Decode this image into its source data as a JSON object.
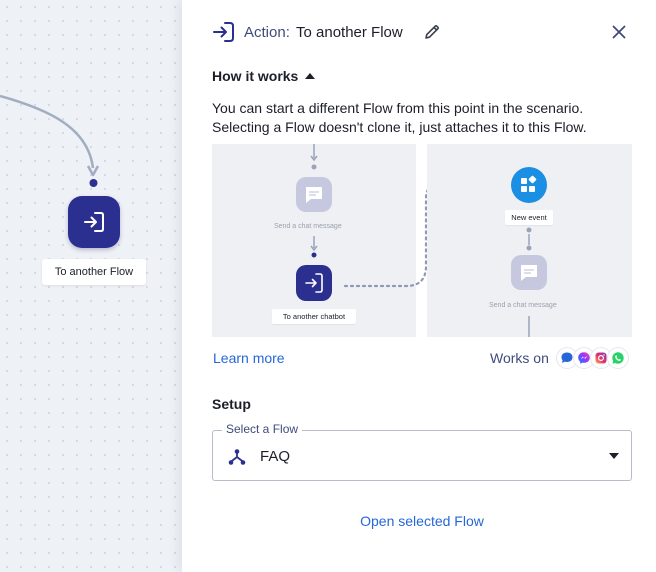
{
  "canvas": {
    "node_label": "To another Flow"
  },
  "panel": {
    "action_prefix": "Action:",
    "action_title": "To another Flow",
    "how_it_works_label": "How it works",
    "description": "You can start a different Flow from this point in the scenario. Selecting a Flow doesn't clone it, just attaches it to this Flow.",
    "illustration": {
      "send_chat_top": "Send a chat message",
      "to_another_chatbot": "To another chatbot",
      "new_event": "New event",
      "send_chat_bottom": "Send a chat message"
    },
    "learn_more": "Learn more",
    "works_on": "Works on",
    "channels": [
      "chat-widget",
      "messenger",
      "instagram",
      "whatsapp"
    ],
    "setup_title": "Setup",
    "select": {
      "legend": "Select a Flow",
      "value": "FAQ"
    },
    "open_selected_flow": "Open selected Flow"
  },
  "colors": {
    "node": "#2b2f8f",
    "link": "#2667d8",
    "event": "#1b8fe3"
  }
}
